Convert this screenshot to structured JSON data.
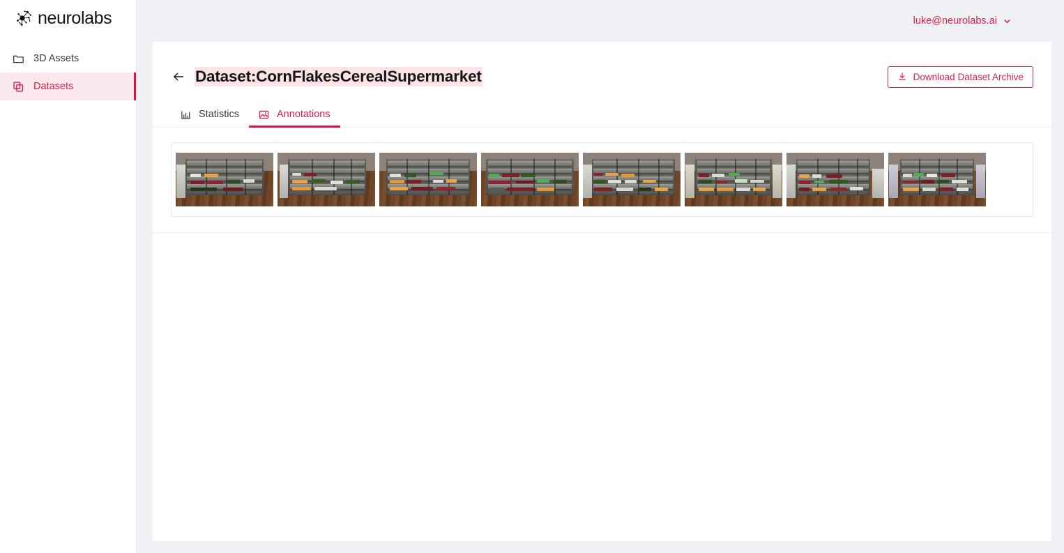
{
  "brand": {
    "name": "neurolabs",
    "logo_icon": "neural-network-logo-icon"
  },
  "sidebar": {
    "items": [
      {
        "label": "3D Assets",
        "icon": "folder-icon",
        "active": false
      },
      {
        "label": "Datasets",
        "icon": "stack-copy-icon",
        "active": true
      }
    ]
  },
  "topbar": {
    "user_email": "luke@neurolabs.ai",
    "chevron_icon": "chevron-down-icon"
  },
  "page": {
    "back_icon": "arrow-left-icon",
    "title": "Dataset:CornFlakesCerealSupermarket",
    "download_button": {
      "label": "Download Dataset Archive",
      "icon": "download-icon"
    }
  },
  "tabs": [
    {
      "label": "Statistics",
      "icon": "bar-chart-icon",
      "active": false
    },
    {
      "label": "Annotations",
      "icon": "image-icon",
      "active": true
    }
  ],
  "annotations": {
    "thumbnails": [
      {
        "name": "annotation-thumbnail-1"
      },
      {
        "name": "annotation-thumbnail-2"
      },
      {
        "name": "annotation-thumbnail-3"
      },
      {
        "name": "annotation-thumbnail-4"
      },
      {
        "name": "annotation-thumbnail-5"
      },
      {
        "name": "annotation-thumbnail-6"
      },
      {
        "name": "annotation-thumbnail-7"
      },
      {
        "name": "annotation-thumbnail-8"
      }
    ]
  },
  "colors": {
    "accent": "#dc1e4b",
    "accent_strong": "#d6124a",
    "accent_soft": "#fce9ee",
    "title_highlight": "#fbe3e6",
    "page_bg": "#f0f1f4",
    "text": "#16161a"
  }
}
